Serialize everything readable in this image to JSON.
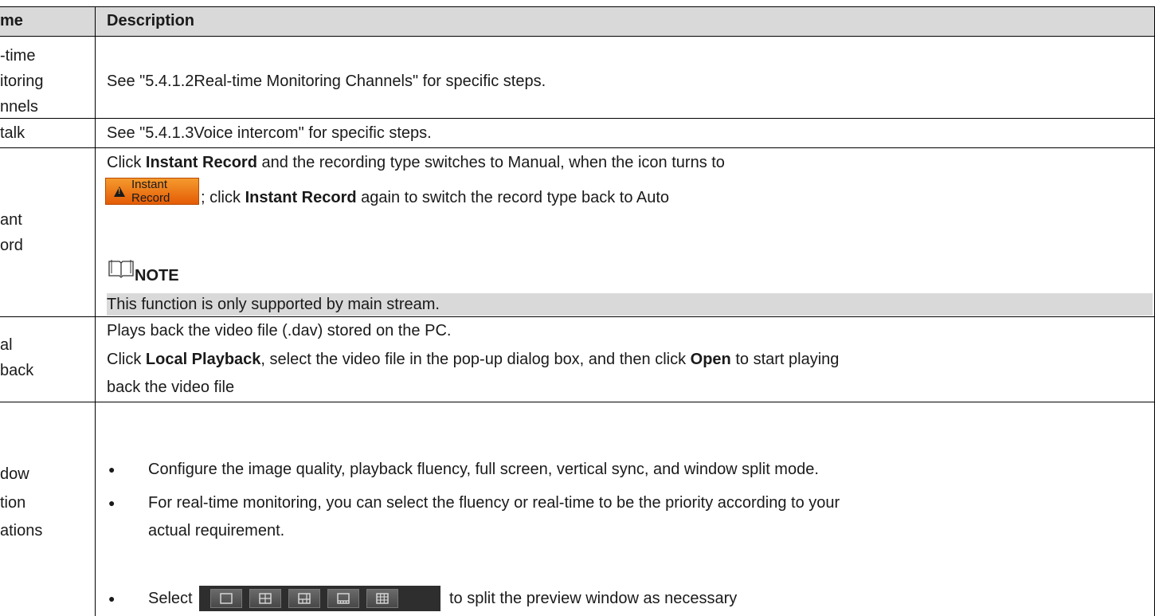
{
  "header": {
    "name_col": "me",
    "description_col": "Description"
  },
  "rows": [
    {
      "name_lines": [
        "-time",
        "itoring",
        "nnels"
      ],
      "description": "See \"5.4.1.2Real-time Monitoring Channels\" for specific steps."
    },
    {
      "name_lines": [
        "talk"
      ],
      "description": "See \"5.4.1.3Voice intercom\" for specific steps."
    },
    {
      "name_lines": [
        "ant",
        "ord"
      ],
      "line1": {
        "pre": "Click ",
        "bold": "Instant Record",
        "post": " and the recording type switches to Manual, when the icon turns to"
      },
      "button_label": "Instant Record",
      "line2": {
        "pre": "; click ",
        "bold": "Instant Record",
        "post": " again to switch the record type back to Auto"
      },
      "note_title": "NOTE",
      "note_text": "This function is only supported by main stream."
    },
    {
      "name_lines": [
        "al",
        "back"
      ],
      "line1": "Plays back the video file (.dav) stored on the PC.",
      "line2": {
        "pre": "Click ",
        "bold1": "Local Playback",
        "mid": ", select the video file in the pop-up dialog box, and then click ",
        "bold2": "Open",
        "post": " to start playing"
      },
      "line3": "back the video file"
    },
    {
      "name_lines": [
        "dow",
        "tion",
        "ations"
      ],
      "bullets": [
        "Configure the image quality, playback fluency, full screen, vertical sync, and window split mode.",
        "For real-time monitoring, you can select the fluency or real-time to be the priority according to your",
        "actual requirement."
      ],
      "select_pre": "Select",
      "select_post": "to split the preview window as necessary",
      "split_icons": [
        "single-split-icon",
        "four-split-icon",
        "six-split-icon",
        "eight-split-icon",
        "nine-split-icon"
      ]
    }
  ],
  "colors": {
    "header_bg": "#d9d9d9",
    "button_orange": "#f08a1e",
    "split_bar": "#2e2e2e"
  }
}
